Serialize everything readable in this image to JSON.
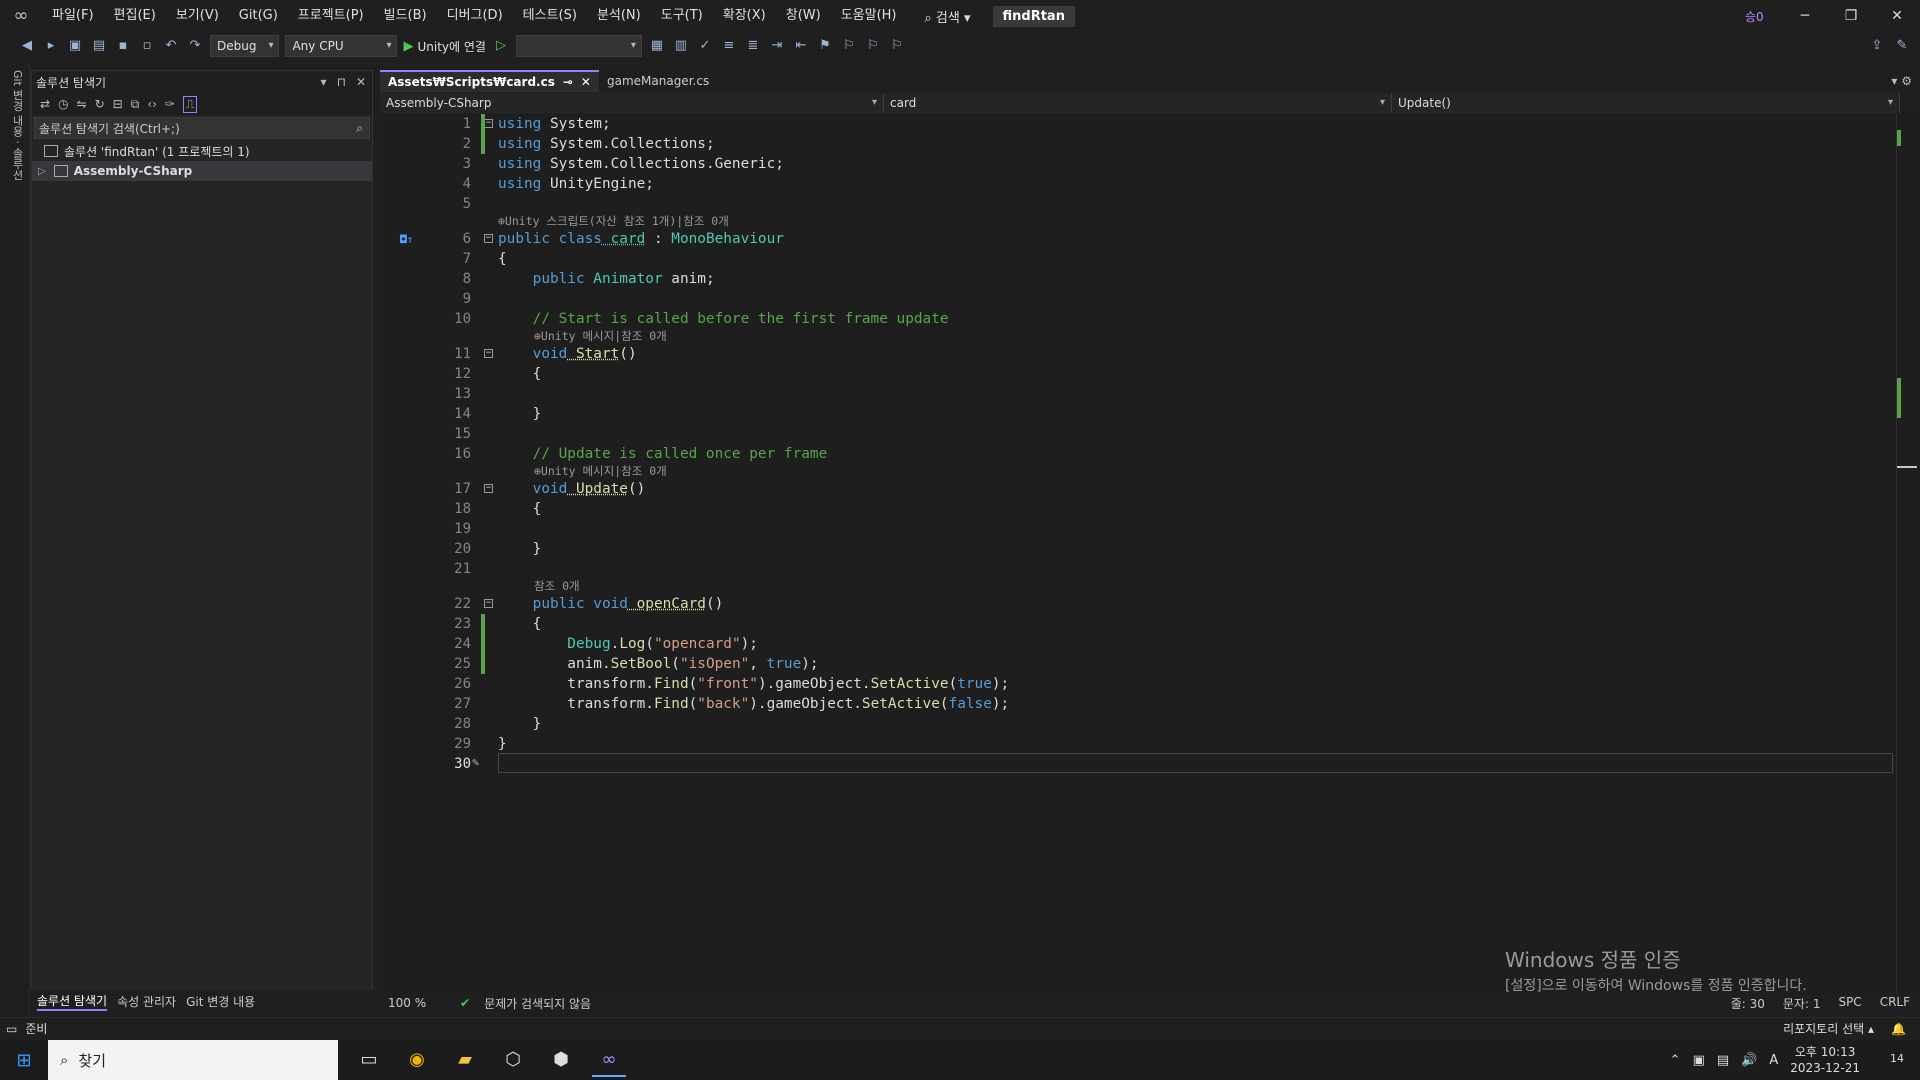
{
  "menubar": {
    "logo_glyph": "∞",
    "items": [
      "파일(F)",
      "편집(E)",
      "보기(V)",
      "Git(G)",
      "프로젝트(P)",
      "빌드(B)",
      "디버그(D)",
      "테스트(S)",
      "분석(N)",
      "도구(T)",
      "확장(X)",
      "창(W)",
      "도움말(H)"
    ],
    "search": "⌕ 검색 ▾",
    "solution_name": "findRtan",
    "live_share": "승0",
    "win_min": "─",
    "win_restore": "❐",
    "win_close": "✕"
  },
  "toolbar": {
    "config": "Debug",
    "platform": "Any CPU",
    "run_label": "Unity에 연결",
    "run_glyph": "▶"
  },
  "left_strip": {
    "label": "Git 변경 내용 · 솔루션"
  },
  "solution_explorer": {
    "title": "솔루션 탐색기",
    "ctrl_dropdown": "▾",
    "ctrl_pin": "⊓",
    "ctrl_close": "✕",
    "search_placeholder": "솔루션 탐색기 검색(Ctrl+;)",
    "search_icon": "⌕",
    "tree": [
      {
        "label": "솔루션 'findRtan' (1 프로젝트의 1)"
      },
      {
        "label": "Assembly-CSharp"
      }
    ],
    "bottom_tabs": [
      "솔루션 탐색기",
      "속성 관리자",
      "Git 변경 내용"
    ]
  },
  "tabs": [
    {
      "label": "Assets₩Scripts₩card.cs",
      "pin": "⊸",
      "close": "✕"
    },
    {
      "label": "gameManager.cs"
    }
  ],
  "navbar": {
    "project": "Assembly-CSharp",
    "type": "card",
    "member": "Update()"
  },
  "code": {
    "lens": {
      "class": "⊕Unity 스크립트(자산 참조 1개)|참조 0개",
      "start": "⊕Unity 메시지|참조 0개",
      "update": "⊕Unity 메시지|참조 0개",
      "opencard": "참조 0개"
    },
    "line_numbers": [
      "1",
      "2",
      "3",
      "4",
      "5",
      "6",
      "7",
      "8",
      "9",
      "10",
      "11",
      "12",
      "13",
      "14",
      "15",
      "16",
      "17",
      "18",
      "19",
      "20",
      "21",
      "22",
      "23",
      "24",
      "25",
      "26",
      "27",
      "28",
      "29",
      "30"
    ],
    "lines": {
      "l1_kw": "using",
      "l1_rest": " System;",
      "l2_kw": "using",
      "l2_rest": " System.Collections;",
      "l3_kw": "using",
      "l3_rest": " System.Collections.Generic;",
      "l4_kw": "using",
      "l4_rest": " UnityEngine;",
      "l6_kw": "public class",
      "l6_name": " card",
      "l6_colon": " : ",
      "l6_base": "MonoBehaviour",
      "l7": "{",
      "l8_kw": "    public",
      "l8_type": " Animator",
      "l8_rest": " anim;",
      "l10": "    // Start is called before the first frame update",
      "l11_kw": "    void",
      "l11_name": " Start",
      "l11_rest": "()",
      "l12": "    {",
      "l14": "    }",
      "l16": "    // Update is called once per frame",
      "l17_kw": "    void",
      "l17_name": " Update",
      "l17_rest": "()",
      "l18": "    {",
      "l20": "    }",
      "l22_kw": "    public void",
      "l22_name": " openCard",
      "l22_rest": "()",
      "l23": "    {",
      "l24_type": "        Debug",
      "l24_dot": ".",
      "l24_m": "Log",
      "l24_o": "(",
      "l24_s": "\"opencard\"",
      "l24_c": ");",
      "l25_a": "        anim.",
      "l25_m": "SetBool",
      "l25_o": "(",
      "l25_s": "\"isOpen\"",
      "l25_c": ", ",
      "l25_k": "true",
      "l25_e": ");",
      "l26_a": "        transform.",
      "l26_m": "Find",
      "l26_o": "(",
      "l26_s": "\"front\"",
      "l26_b": ").gameObject.",
      "l26_m2": "SetActive",
      "l26_o2": "(",
      "l26_k": "true",
      "l26_e": ");",
      "l27_a": "        transform.",
      "l27_m": "Find",
      "l27_o": "(",
      "l27_s": "\"back\"",
      "l27_b": ").gameObject.",
      "l27_m2": "SetActive",
      "l27_o2": "(",
      "l27_k": "false",
      "l27_e": ");",
      "l28": "    }",
      "l29": "}"
    }
  },
  "editor_status": {
    "zoom": "100 %",
    "issues": "문제가 검색되지 않음",
    "line": "줄: 30",
    "char": "문자: 1",
    "spc": "SPC",
    "crlf": "CRLF"
  },
  "watermark": {
    "title": "Windows 정품 인증",
    "sub": "[설정]으로 이동하여 Windows를 정품 인증합니다."
  },
  "statusbar": {
    "ready": "준비",
    "repo": "리포지토리 선택 ▴"
  },
  "taskbar": {
    "search": "찾기",
    "time": "오후 10:13",
    "date": "2023-12-21",
    "ime": "A",
    "notif": "14"
  },
  "colors": {
    "accent": "#9d7bff",
    "keyword": "#569cd6",
    "type": "#4ec9b0",
    "comment": "#57a64a",
    "string": "#d69d85",
    "method": "#dcdcaa"
  }
}
